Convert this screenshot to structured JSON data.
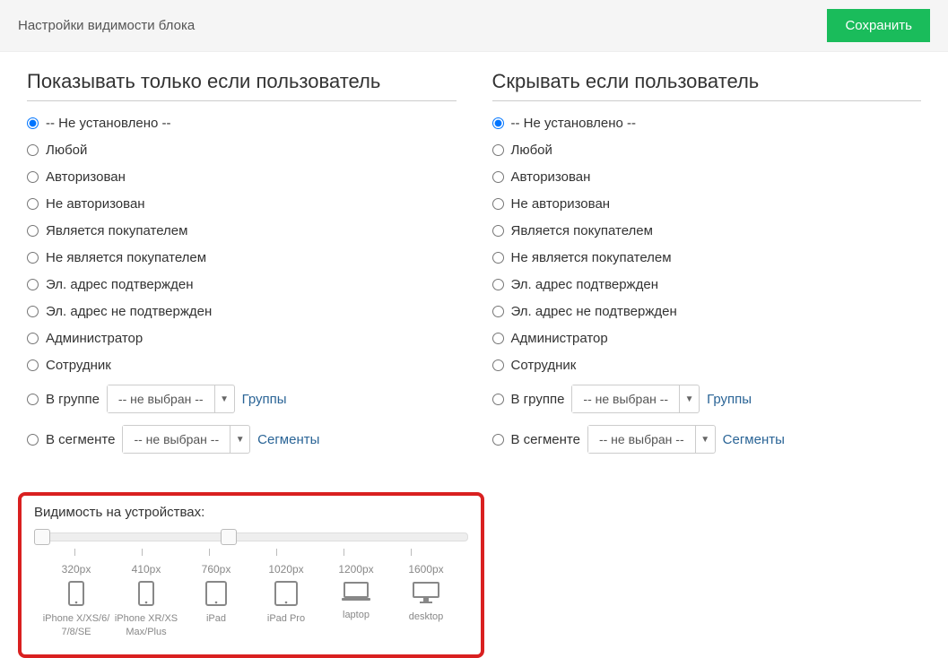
{
  "header": {
    "title": "Настройки видимости блока",
    "save": "Сохранить"
  },
  "columns": {
    "show": {
      "heading": "Показывать только если пользователь"
    },
    "hide": {
      "heading": "Скрывать если пользователь"
    }
  },
  "options": {
    "not_set": "-- Не установлено --",
    "any": "Любой",
    "authorized": "Авторизован",
    "not_authorized": "Не авторизован",
    "buyer": "Является покупателем",
    "not_buyer": "Не является покупателем",
    "email_ok": "Эл. адрес подтвержден",
    "email_no": "Эл. адрес не подтвержден",
    "admin": "Администратор",
    "staff": "Сотрудник",
    "in_group": "В группе",
    "in_segment": "В сегменте"
  },
  "select": {
    "not_chosen": "-- не выбран --",
    "groups_link": "Группы",
    "segments_link": "Сегменты"
  },
  "devices": {
    "title": "Видимость на устройствах:",
    "items": [
      {
        "px": "320px",
        "name": "iPhone X/XS/6/ 7/8/SE"
      },
      {
        "px": "410px",
        "name": "iPhone XR/XS Max/Plus"
      },
      {
        "px": "760px",
        "name": "iPad"
      },
      {
        "px": "1020px",
        "name": "iPad Pro"
      },
      {
        "px": "1200px",
        "name": "laptop"
      },
      {
        "px": "1600px",
        "name": "desktop"
      }
    ]
  }
}
